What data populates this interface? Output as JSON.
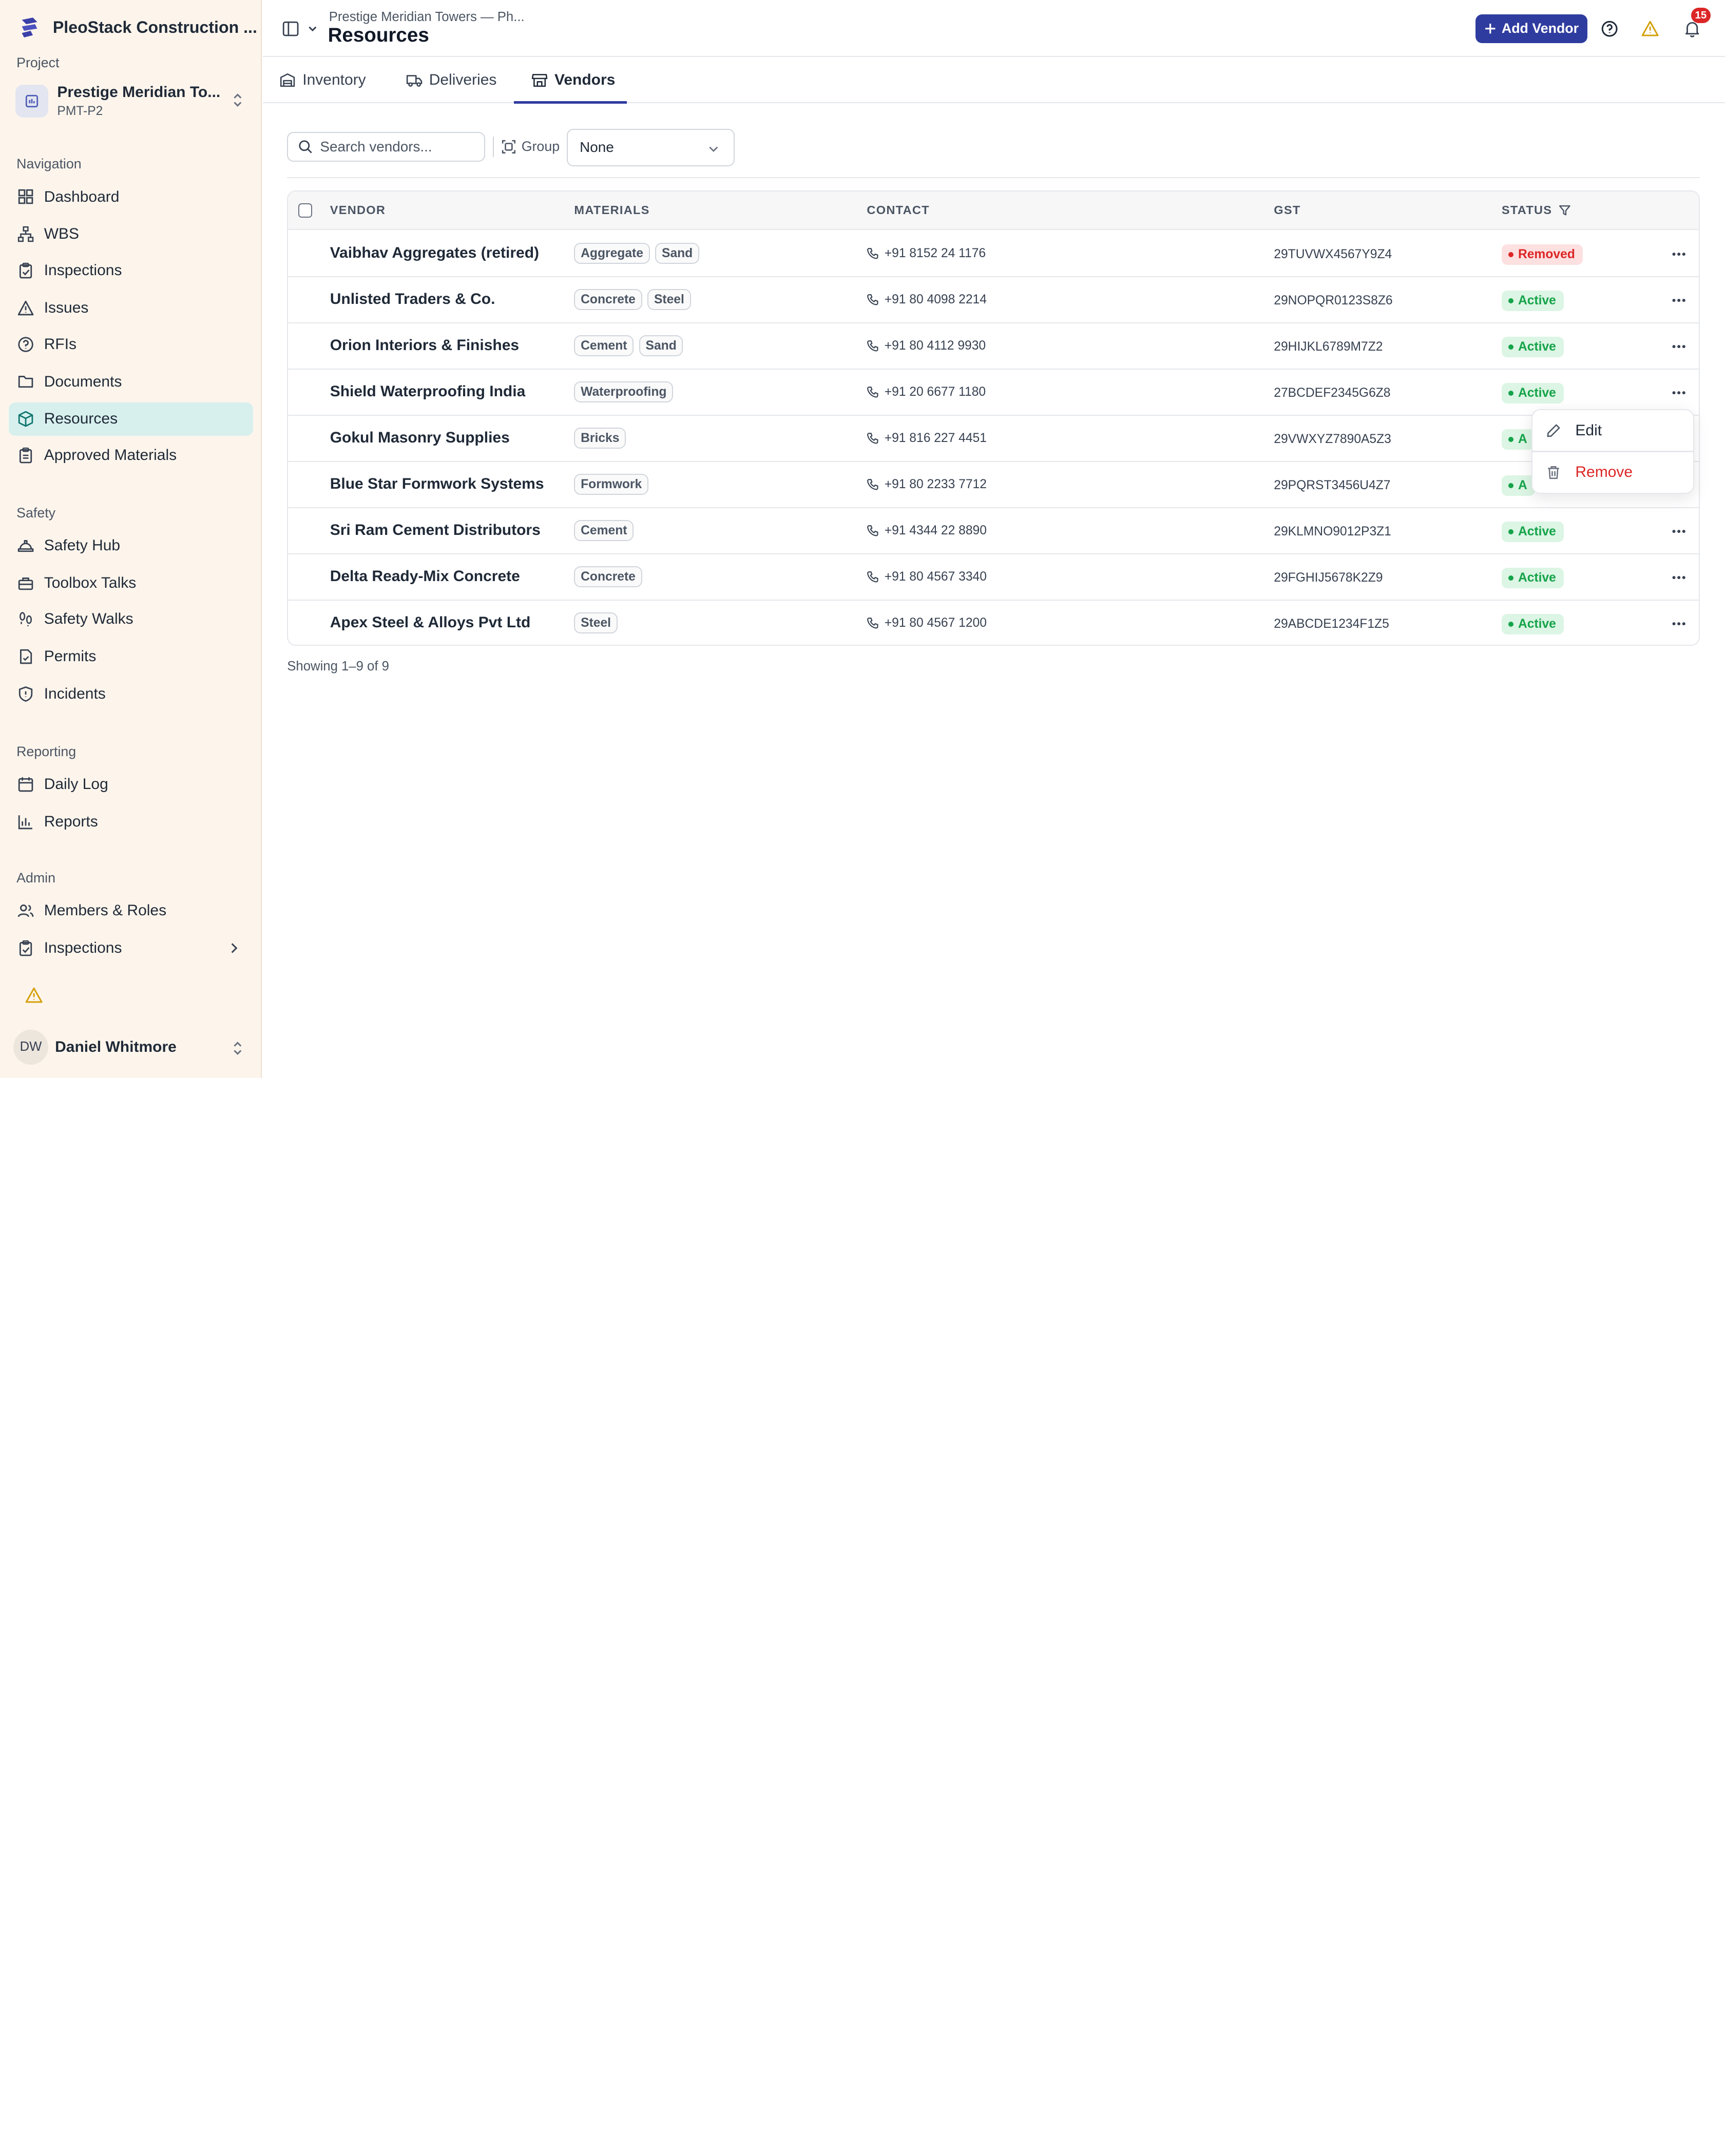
{
  "app": {
    "name": "PleoStack Construction ..."
  },
  "sidebar": {
    "project_label": "Project",
    "project": {
      "name": "Prestige Meridian To...",
      "code": "PMT-P2"
    },
    "sections": {
      "navigation": "Navigation",
      "safety": "Safety",
      "reporting": "Reporting",
      "admin": "Admin"
    },
    "items": {
      "dashboard": "Dashboard",
      "wbs": "WBS",
      "inspections": "Inspections",
      "issues": "Issues",
      "rfis": "RFIs",
      "documents": "Documents",
      "resources": "Resources",
      "approved_materials": "Approved Materials",
      "safety_hub": "Safety Hub",
      "toolbox_talks": "Toolbox Talks",
      "safety_walks": "Safety Walks",
      "permits": "Permits",
      "incidents": "Incidents",
      "daily_log": "Daily Log",
      "reports": "Reports",
      "members_roles": "Members & Roles",
      "admin_inspections": "Inspections"
    },
    "active_item": "resources",
    "user": {
      "initials": "DW",
      "name": "Daniel Whitmore"
    }
  },
  "header": {
    "breadcrumb": "Prestige Meridian Towers — Ph...",
    "title": "Resources",
    "add_button": "Add Vendor",
    "notification_count": "15"
  },
  "tabs": [
    {
      "label": "Inventory",
      "icon": "box-icon"
    },
    {
      "label": "Deliveries",
      "icon": "truck-icon"
    },
    {
      "label": "Vendors",
      "icon": "store-icon",
      "active": true
    }
  ],
  "toolbar": {
    "search_placeholder": "Search vendors...",
    "group_label": "Group",
    "group_value": "None"
  },
  "table": {
    "columns": {
      "vendor": "VENDOR",
      "materials": "MATERIALS",
      "contact": "CONTACT",
      "gst": "GST",
      "status": "STATUS"
    },
    "rows": [
      {
        "vendor": "Vaibhav Aggregates (retired)",
        "materials": [
          "Aggregate",
          "Sand"
        ],
        "contact": "+91 8152 24 1176",
        "gst": "29TUVWX4567Y9Z4",
        "status": "Removed"
      },
      {
        "vendor": "Unlisted Traders & Co.",
        "materials": [
          "Concrete",
          "Steel"
        ],
        "contact": "+91 80 4098 2214",
        "gst": "29NOPQR0123S8Z6",
        "status": "Active"
      },
      {
        "vendor": "Orion Interiors & Finishes",
        "materials": [
          "Cement",
          "Sand"
        ],
        "contact": "+91 80 4112 9930",
        "gst": "29HIJKL6789M7Z2",
        "status": "Active"
      },
      {
        "vendor": "Shield Waterproofing India",
        "materials": [
          "Waterproofing"
        ],
        "contact": "+91 20 6677 1180",
        "gst": "27BCDEF2345G6Z8",
        "status": "Active"
      },
      {
        "vendor": "Gokul Masonry Supplies",
        "materials": [
          "Bricks"
        ],
        "contact": "+91 816 227 4451",
        "gst": "29VWXYZ7890A5Z3",
        "status": "A"
      },
      {
        "vendor": "Blue Star Formwork Systems",
        "materials": [
          "Formwork"
        ],
        "contact": "+91 80 2233 7712",
        "gst": "29PQRST3456U4Z7",
        "status": "A"
      },
      {
        "vendor": "Sri Ram Cement Distributors",
        "materials": [
          "Cement"
        ],
        "contact": "+91 4344 22 8890",
        "gst": "29KLMNO9012P3Z1",
        "status": "Active"
      },
      {
        "vendor": "Delta Ready-Mix Concrete",
        "materials": [
          "Concrete"
        ],
        "contact": "+91 80 4567 3340",
        "gst": "29FGHIJ5678K2Z9",
        "status": "Active"
      },
      {
        "vendor": "Apex Steel & Alloys Pvt Ltd",
        "materials": [
          "Steel"
        ],
        "contact": "+91 80 4567 1200",
        "gst": "29ABCDE1234F1Z5",
        "status": "Active"
      }
    ],
    "footer": "Showing 1–9 of 9"
  },
  "context_menu": {
    "edit": "Edit",
    "remove": "Remove"
  },
  "colors": {
    "accent": "#2f3c9f",
    "active": "#16a34a",
    "removed": "#dc2626",
    "sidebar_bg": "#fdf5ec",
    "sidebar_active": "#d7f0ee"
  }
}
